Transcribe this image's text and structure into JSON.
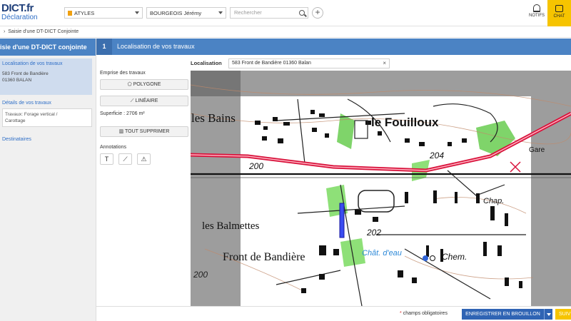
{
  "app": {
    "logo_title": "DICT.fr",
    "logo_subtitle": "Déclaration"
  },
  "header": {
    "company": "ATYLES",
    "user": "BOURGEOIS Jérémy",
    "search_placeholder": "Rechercher",
    "add_symbol": "+",
    "notifs_label": "NOTIFS",
    "chat_label": "CHAT"
  },
  "breadcrumb": {
    "chevron": "›",
    "label": "Saisie d'une DT-DICT Conjointe"
  },
  "left": {
    "title": "isie d'une DT-DICT conjointe",
    "steps": [
      {
        "label": "Localisation de vos travaux",
        "detail_line1": "583 Front de Bandière",
        "detail_line2": "01360 BALAN"
      },
      {
        "label": "Détails de vos travaux",
        "detail_line1": "Travaux: Forage vertical /",
        "detail_line2": "Carottage"
      },
      {
        "label": "Destinataires"
      }
    ]
  },
  "step": {
    "number": "1",
    "title": "Localisation de vos travaux"
  },
  "tools": {
    "emprise_label": "Emprise des travaux",
    "polygone": "POLYGONE",
    "lineaire": "LINÉAIRE",
    "superficie": "Superficie : 2706 m²",
    "tout_supprimer": "TOUT SUPPRIMER",
    "annotations_label": "Annotations",
    "annot_text_symbol": "T",
    "annot_line_symbol": "⟋",
    "annot_warn_symbol": "⚠"
  },
  "localisation": {
    "label": "Localisation",
    "value": "583 Front de Bandière 01360 Balan",
    "clear_symbol": "×"
  },
  "map": {
    "labels": {
      "les_bains": "les Bains",
      "le_fouilloux": "le Fouilloux",
      "les_balmettes": "les Balmettes",
      "front_de_bandiere": "Front de Bandière",
      "chat_deau": "Chât. d'eau",
      "chem": "Chem.",
      "chap": "Chap.",
      "gare": "Gare",
      "alt_200": "200",
      "alt_202": "202",
      "alt_204": "204"
    }
  },
  "footer": {
    "required_star": "*",
    "required_text": "champs obligatoires",
    "save_label": "ENREGISTRER EN BROUILLON",
    "next_label": "SUIV"
  },
  "colors": {
    "primary": "#4b83c4",
    "accent_yellow": "#f6c400",
    "save_blue": "#2f64b4",
    "road_red": "#d8123b"
  }
}
